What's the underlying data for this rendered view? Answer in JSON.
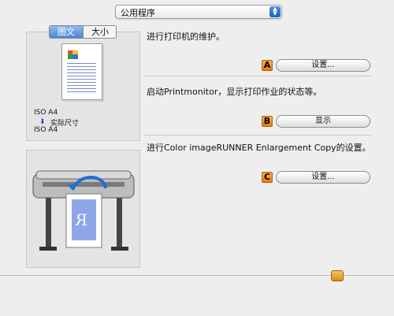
{
  "top_select": {
    "label": "公用程序"
  },
  "preview": {
    "tabs": [
      "图文",
      "大小"
    ],
    "paper_size_1": "ISO A4",
    "scale_label": "实际尺寸",
    "paper_size_2": "ISO A4"
  },
  "sections": [
    {
      "text": "进行打印机的维护。",
      "badge": "A",
      "button": "设置..."
    },
    {
      "text": "启动Printmonitor，显示打印作业的状态等。",
      "badge": "B",
      "button": "显示"
    },
    {
      "text": "进行Color imageRUNNER Enlargement Copy的设置。",
      "badge": "C",
      "button": "设置..."
    }
  ],
  "icons": {
    "select_arrows": "up-down-arrows-icon",
    "scale_arrow": "arrow-down-icon",
    "lock": "lock-icon",
    "printer": "large-format-printer-illustration"
  }
}
